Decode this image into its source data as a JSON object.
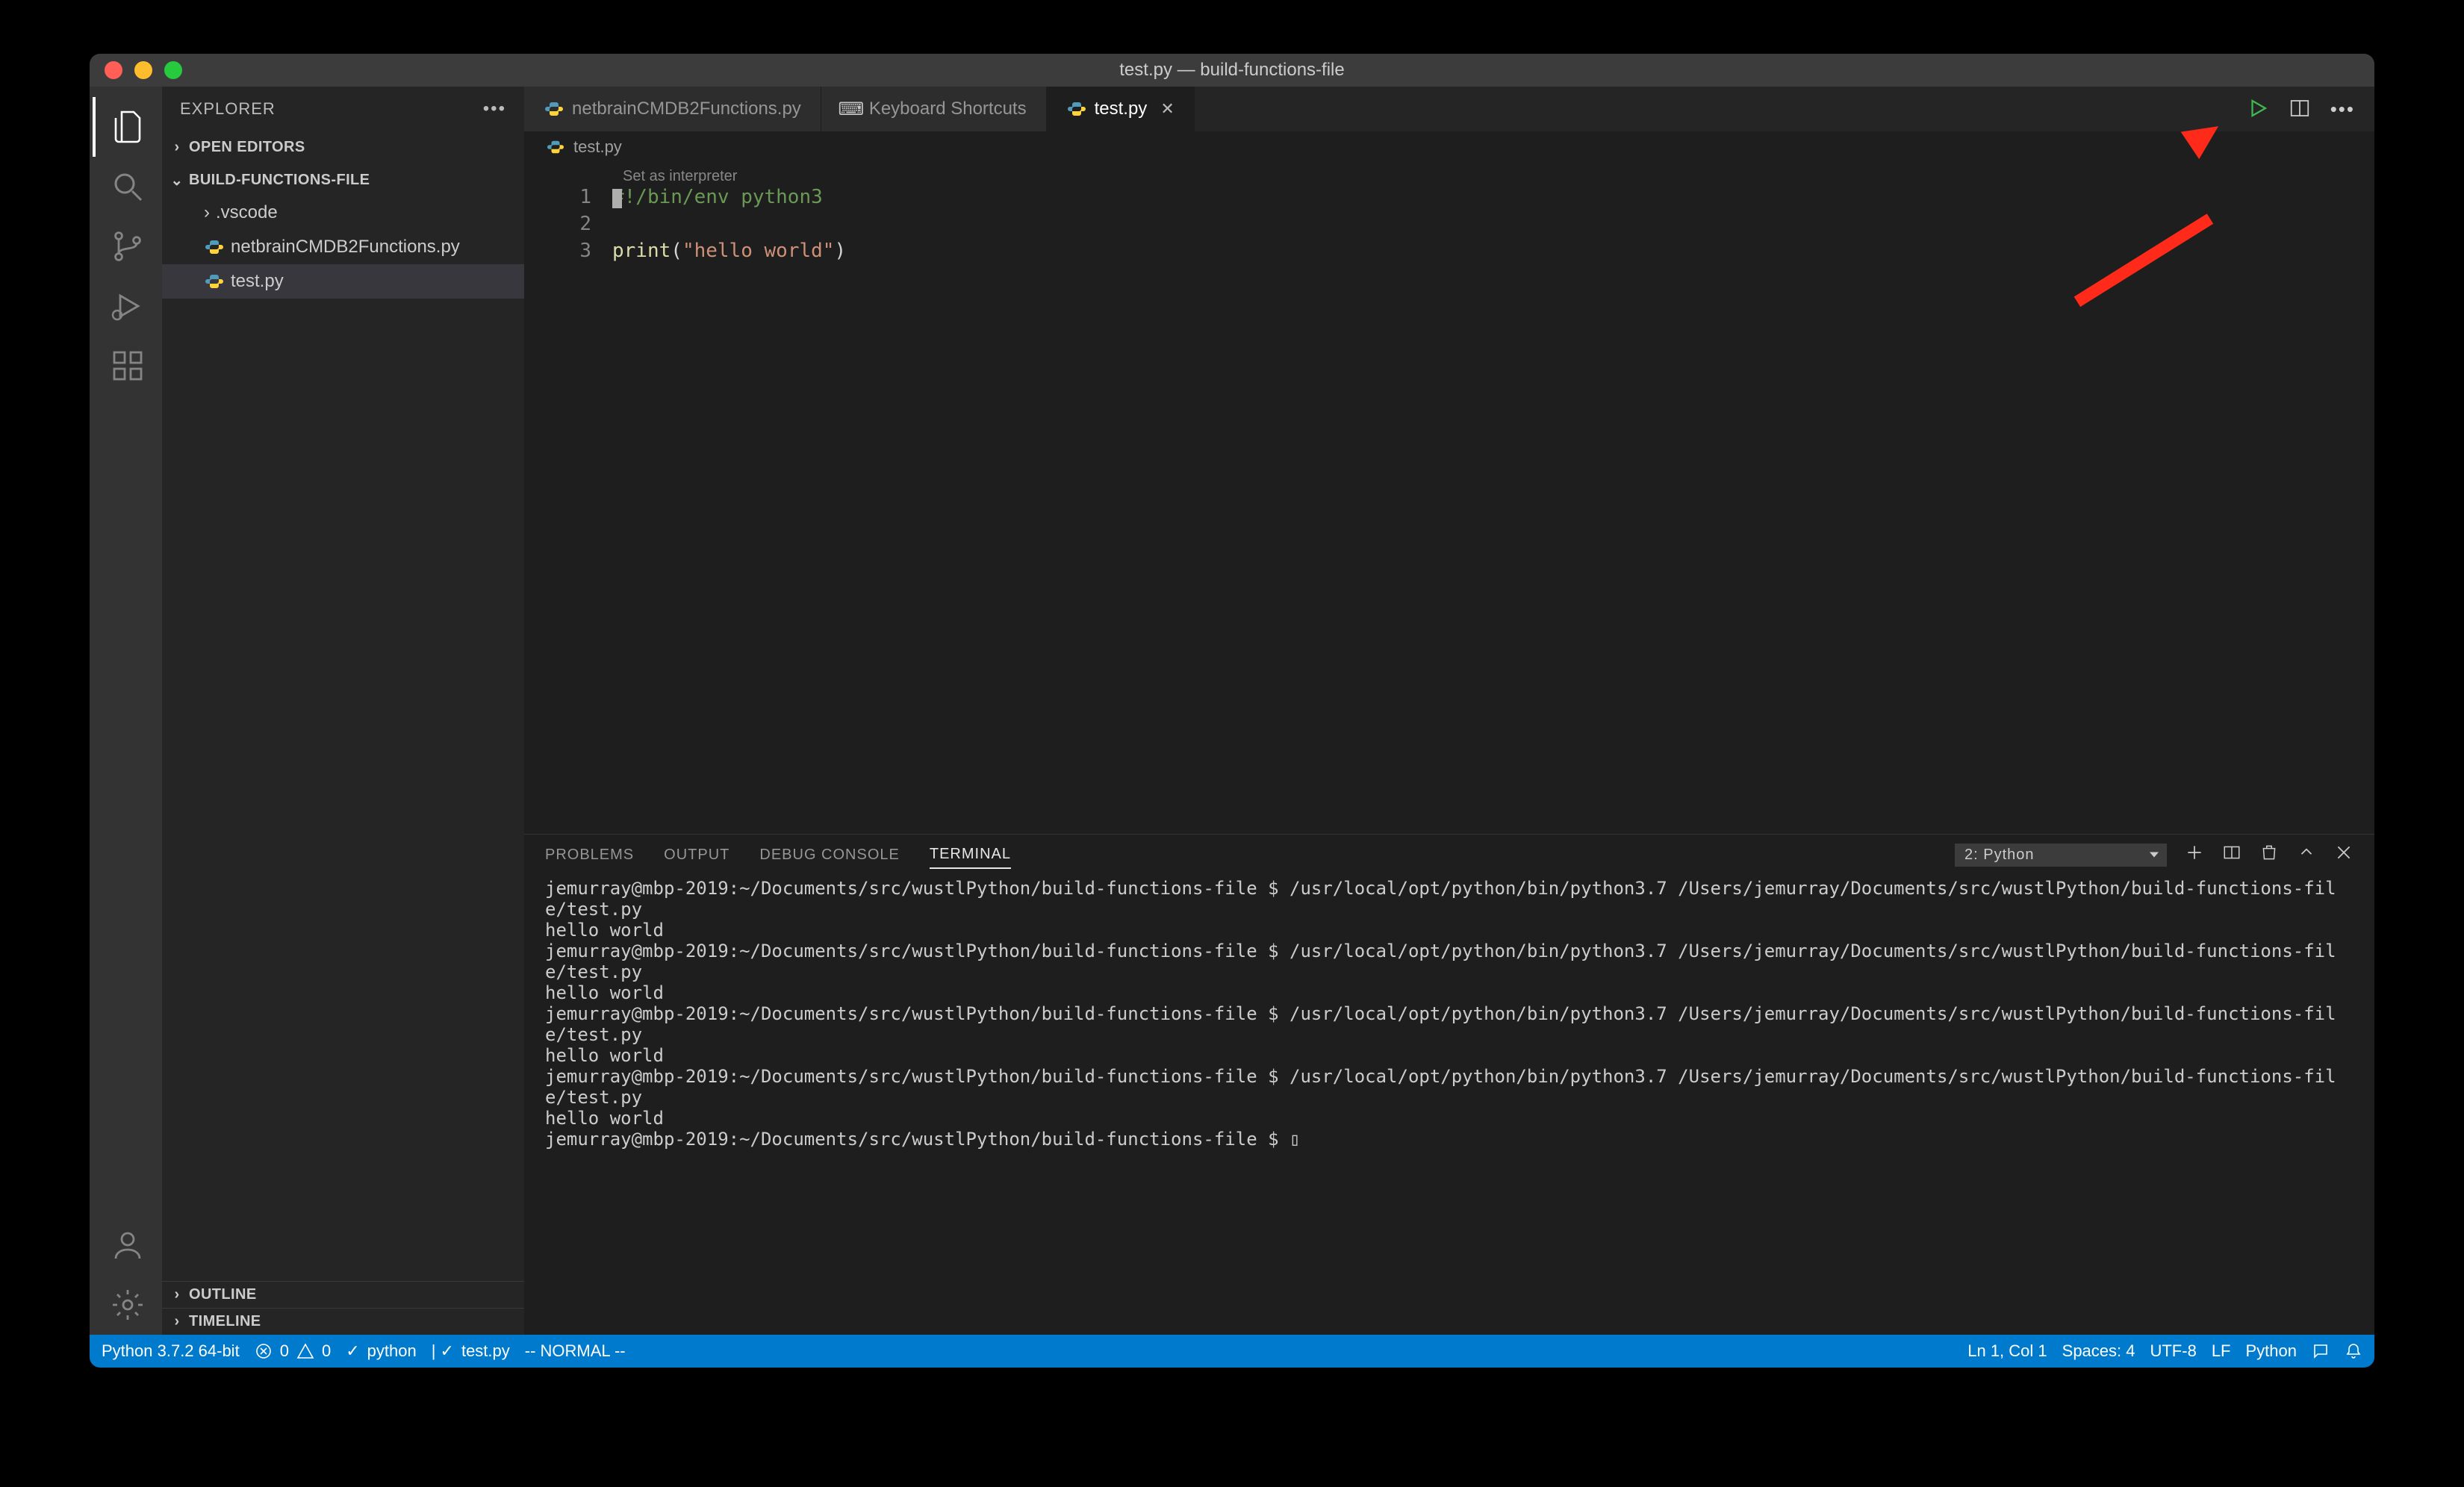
{
  "title": "test.py — build-functions-file",
  "sidebar": {
    "title": "EXPLORER",
    "open_editors": "OPEN EDITORS",
    "folder": "BUILD-FUNCTIONS-FILE",
    "items": [
      {
        "name": ".vscode",
        "kind": "folder"
      },
      {
        "name": "netbrainCMDB2Functions.py",
        "kind": "py"
      },
      {
        "name": "test.py",
        "kind": "py",
        "selected": true
      }
    ],
    "outline": "OUTLINE",
    "timeline": "TIMELINE"
  },
  "tabs": [
    {
      "label": "netbrainCMDB2Functions.py",
      "icon": "py"
    },
    {
      "label": "Keyboard Shortcuts",
      "icon": "kb"
    },
    {
      "label": "test.py",
      "icon": "py",
      "active": true,
      "close": true
    }
  ],
  "breadcrumb": {
    "file": "test.py"
  },
  "editor": {
    "hint": "Set as interpreter",
    "lines": [
      "1",
      "2",
      "3"
    ],
    "code": {
      "l1_a": "#",
      "l1_b": "!/bin/env python3",
      "l3_fn": "print",
      "l3_paren_o": "(",
      "l3_str": "\"hello world\"",
      "l3_paren_c": ")"
    }
  },
  "panel": {
    "tabs": [
      "PROBLEMS",
      "OUTPUT",
      "DEBUG CONSOLE",
      "TERMINAL"
    ],
    "active": "TERMINAL",
    "selector": "2: Python",
    "terminal": "jemurray@mbp-2019:~/Documents/src/wustlPython/build-functions-file $ /usr/local/opt/python/bin/python3.7 /Users/jemurray/Documents/src/wustlPython/build-functions-file/test.py\nhello world\njemurray@mbp-2019:~/Documents/src/wustlPython/build-functions-file $ /usr/local/opt/python/bin/python3.7 /Users/jemurray/Documents/src/wustlPython/build-functions-file/test.py\nhello world\njemurray@mbp-2019:~/Documents/src/wustlPython/build-functions-file $ /usr/local/opt/python/bin/python3.7 /Users/jemurray/Documents/src/wustlPython/build-functions-file/test.py\nhello world\njemurray@mbp-2019:~/Documents/src/wustlPython/build-functions-file $ /usr/local/opt/python/bin/python3.7 /Users/jemurray/Documents/src/wustlPython/build-functions-file/test.py\nhello world\njemurray@mbp-2019:~/Documents/src/wustlPython/build-functions-file $ ▯"
  },
  "status": {
    "python": "Python 3.7.2 64-bit",
    "errors": "0",
    "warnings": "0",
    "git_py": "python",
    "git_file": "test.py",
    "vim": "-- NORMAL --",
    "lncol": "Ln 1, Col 1",
    "spaces": "Spaces: 4",
    "enc": "UTF-8",
    "eol": "LF",
    "lang": "Python"
  }
}
